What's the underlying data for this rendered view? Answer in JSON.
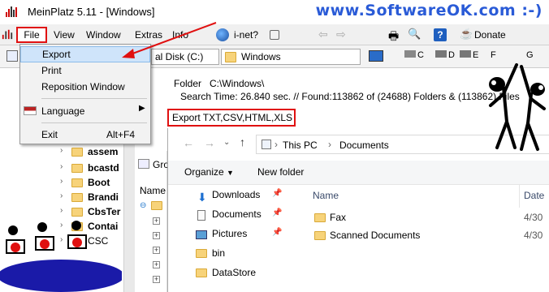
{
  "window": {
    "title": "MeinPlatz 5.11 - [Windows]"
  },
  "watermark": "www.SoftwareOK.com :-)",
  "menubar": {
    "items": [
      "File",
      "View",
      "Window",
      "Extras",
      "Info"
    ],
    "inet_label": "i-net?",
    "donate_label": "Donate"
  },
  "file_menu": {
    "export_label": "Export",
    "print_label": "Print",
    "reposition_label": "Reposition Window",
    "language_label": "Language",
    "exit_label": "Exit",
    "exit_shortcut": "Alt+F4"
  },
  "pathbar": {
    "drive_value": "al Disk (C:)",
    "folder_value": "Windows",
    "drive_letters": [
      "C",
      "D",
      "E",
      "F",
      "G"
    ]
  },
  "info": {
    "folder_label": "Folder",
    "folder_value": "C:\\Windows\\",
    "search_text": "Search Time: 26.840 sec. //  Found:113862 of (24688) Folders & (113862) Files"
  },
  "export_formats": "Export TXT,CSV,HTML,XLS",
  "tree": {
    "items": [
      "assem",
      "bcastd",
      "Boot",
      "Brandi",
      "CbsTer",
      "Contai",
      "CSC"
    ],
    "group_label": "Gro",
    "name_label": "Name"
  },
  "dialog": {
    "breadcrumb": [
      "This PC",
      "Documents"
    ],
    "organize_label": "Organize",
    "new_folder_label": "New folder",
    "nav_items": [
      "Downloads",
      "Documents",
      "Pictures",
      "bin",
      "DataStore"
    ],
    "column_name": "Name",
    "column_date": "Date",
    "files": [
      {
        "name": "Fax",
        "date": "4/30"
      },
      {
        "name": "Scanned Documents",
        "date": "4/30"
      }
    ]
  },
  "colors": {
    "highlight_red": "#e01010",
    "menu_selected": "#cfe4fa",
    "folder_yellow": "#f7d37a"
  }
}
